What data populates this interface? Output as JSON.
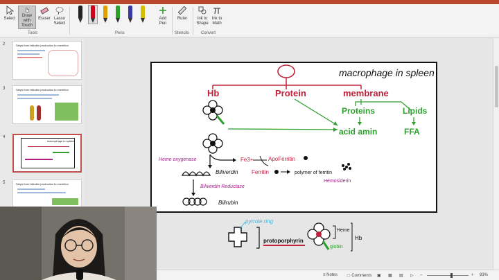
{
  "ribbon": {
    "tools": {
      "select_label": "Select",
      "draw_touch_label": "Draw with Touch",
      "eraser_label": "Eraser",
      "lasso_label": "Lasso Select",
      "group_label": "Tools"
    },
    "pens": {
      "add_pen_label": "Add Pen",
      "group_label": "Pens",
      "colors": [
        "#222222",
        "#d0021b",
        "#e0a000",
        "#2e9e2e",
        "#3a3aa0",
        "#d4c000"
      ]
    },
    "stencils": {
      "ruler_label": "Ruler",
      "group_label": "Stencils"
    },
    "convert": {
      "ink_to_shape_label": "Ink to Shape",
      "ink_to_math_label": "Ink to Math",
      "group_label": "Convert"
    }
  },
  "thumbnails": [
    {
      "number": "2",
      "title": "Steps from bilirubin production to excretion"
    },
    {
      "number": "3",
      "title": "Steps from bilirubin production to excretion"
    },
    {
      "number": "4",
      "title": "macrophage in spleen"
    },
    {
      "number": "5",
      "title": "Steps from bilirubin production to excretion"
    }
  ],
  "slide": {
    "title": "macrophage in spleen",
    "labels": {
      "hb": "Hb",
      "protein": "Protein",
      "membrane": "membrane",
      "proteins": "Proteins",
      "lipids": "Lipids",
      "acid_amin": "acid amin",
      "ffa": "FFA",
      "heme_oxygenase": "Heme oxygenase",
      "fe3": "Fe3+",
      "apoferritin": "ApoFerritin",
      "biliverdin": "Biliverdin",
      "ferritin": "Ferritin",
      "polymer": "polymer of ferritin",
      "hemosiderin": "Hemosiderin",
      "biliverdin_reductase": "Biliverdin Reductase",
      "bilirubin": "Bilirubin"
    }
  },
  "below_slide": {
    "pyrrole_ring": "pyrrole ring",
    "protoporphyrin": "protoporphyrin",
    "heme": "Heme",
    "globin": "globin",
    "hb": "Hb"
  },
  "statusbar": {
    "notes_label": "Notes",
    "comments_label": "Comments",
    "zoom": "83%"
  }
}
